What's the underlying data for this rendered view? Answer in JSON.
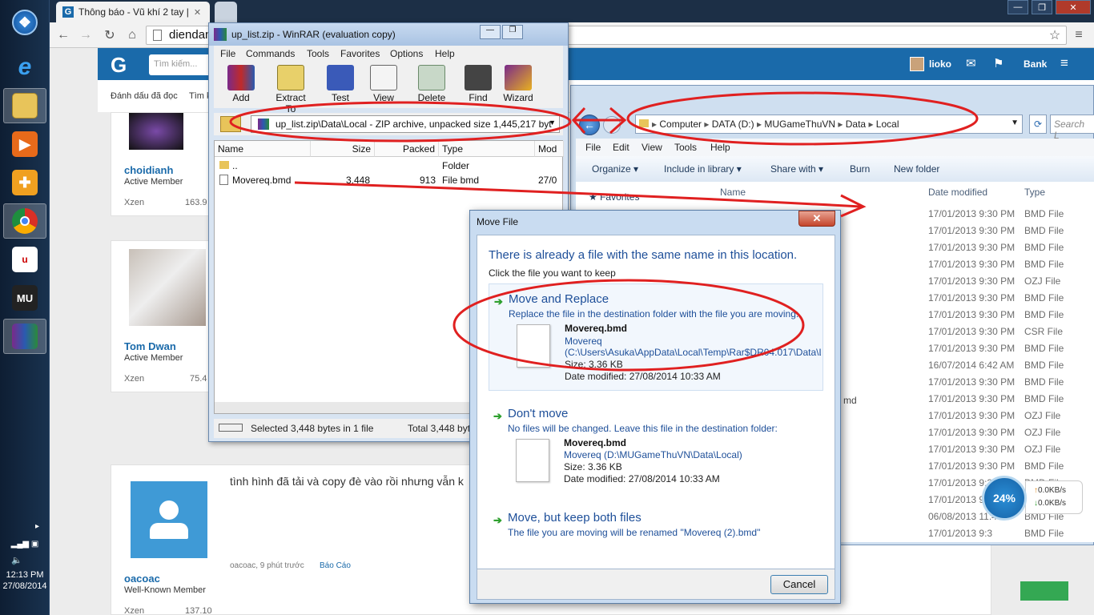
{
  "taskbar": {
    "clock_time": "12:13 PM",
    "clock_date": "27/08/2014"
  },
  "browser": {
    "tab_title": "Thông báo - Vũ khí 2 tay |",
    "url": "diendan"
  },
  "forum": {
    "search_placeholder": "Tìm kiếm...",
    "subnav_mark_read": "Đánh dấu đã đọc",
    "subnav_search": "Tìm k",
    "header_user": "lioko",
    "header_bank": "Bank",
    "posts": [
      {
        "user": "choidianh",
        "role": "Active Member",
        "stat_label": "Xzen",
        "stat_value": "163.9"
      },
      {
        "user": "Tom Dwan",
        "role": "Active Member",
        "stat_label": "Xzen",
        "stat_value": "75.4"
      },
      {
        "user": "oacoac",
        "role": "Well-Known Member",
        "stat_label": "Xzen",
        "stat_value": "137.10",
        "message": "tình hình đã tải và copy đè vào rồi nhưng vẫn k",
        "meta": "oacoac, 9 phút trước",
        "report": "Báo Cáo"
      }
    ]
  },
  "winrar": {
    "title": "up_list.zip - WinRAR (evaluation copy)",
    "menu": [
      "File",
      "Commands",
      "Tools",
      "Favorites",
      "Options",
      "Help"
    ],
    "toolbar": [
      "Add",
      "Extract To",
      "Test",
      "View",
      "Delete",
      "Find",
      "Wizard"
    ],
    "path": "up_list.zip\\Data\\Local - ZIP archive, unpacked size 1,445,217 byt",
    "columns": [
      "Name",
      "Size",
      "Packed",
      "Type",
      "Mod"
    ],
    "rows": [
      {
        "name": "..",
        "size": "",
        "packed": "",
        "type": "Folder",
        "mod": ""
      },
      {
        "name": "Movereq.bmd",
        "size": "3,448",
        "packed": "913",
        "type": "File bmd",
        "mod": "27/0"
      }
    ],
    "status_selected": "Selected 3,448 bytes in 1 file",
    "status_total": "Total 3,448 byt"
  },
  "explorer": {
    "breadcrumb": [
      "Computer",
      "DATA (D:)",
      "MUGameThuVN",
      "Data",
      "Local"
    ],
    "search_placeholder": "Search L",
    "menu": [
      "File",
      "Edit",
      "View",
      "Tools",
      "Help"
    ],
    "commands": [
      "Organize",
      "Include in library",
      "Share with",
      "Burn",
      "New folder"
    ],
    "columns": [
      "Name",
      "Date modified",
      "Type"
    ],
    "favorites": "Favorites",
    "rows": [
      {
        "date": "17/01/2013 9:30 PM",
        "type": "BMD File"
      },
      {
        "date": "17/01/2013 9:30 PM",
        "type": "BMD File"
      },
      {
        "date": "17/01/2013 9:30 PM",
        "type": "BMD File"
      },
      {
        "date": "17/01/2013 9:30 PM",
        "type": "BMD File"
      },
      {
        "date": "17/01/2013 9:30 PM",
        "type": "OZJ File"
      },
      {
        "date": "17/01/2013 9:30 PM",
        "type": "BMD File"
      },
      {
        "date": "17/01/2013 9:30 PM",
        "type": "BMD File"
      },
      {
        "date": "17/01/2013 9:30 PM",
        "type": "CSR File"
      },
      {
        "date": "17/01/2013 9:30 PM",
        "type": "BMD File"
      },
      {
        "date": "16/07/2014 6:42 AM",
        "type": "BMD File"
      },
      {
        "date": "17/01/2013 9:30 PM",
        "type": "BMD File"
      },
      {
        "date": "17/01/2013 9:30 PM",
        "type": "BMD File"
      },
      {
        "date": "17/01/2013 9:30 PM",
        "type": "OZJ File"
      },
      {
        "date": "17/01/2013 9:30 PM",
        "type": "OZJ File"
      },
      {
        "date": "17/01/2013 9:30 PM",
        "type": "OZJ File"
      },
      {
        "date": "17/01/2013 9:30 PM",
        "type": "BMD File"
      },
      {
        "date": "17/01/2013 9:3",
        "type": "BMD File"
      },
      {
        "date": "17/01/2013 9:3",
        "type": "BMD File"
      },
      {
        "date": "06/08/2013 11:4",
        "type": "BMD File"
      },
      {
        "date": "17/01/2013 9:3",
        "type": "BMD File"
      }
    ],
    "partial_name": "md"
  },
  "dialog": {
    "title": "Move File",
    "close": "✕",
    "heading": "There is already a file with the same name in this location.",
    "subheading": "Click the file you want to keep",
    "opt1_title": "Move and Replace",
    "opt1_desc": "Replace the file in the destination folder with the file you are moving:",
    "opt1_fname": "Movereq.bmd",
    "opt1_loc1": "Movereq",
    "opt1_loc2": "(C:\\Users\\Asuka\\AppData\\Local\\Temp\\Rar$DR04.017\\Data\\L",
    "opt1_size": "Size: 3.36 KB",
    "opt1_date": "Date modified: 27/08/2014 10:33 AM",
    "opt2_title": "Don't move",
    "opt2_desc": "No files will be changed. Leave this file in the destination folder:",
    "opt2_fname": "Movereq.bmd",
    "opt2_loc": "Movereq (D:\\MUGameThuVN\\Data\\Local)",
    "opt2_size": "Size: 3.36 KB",
    "opt2_date": "Date modified: 27/08/2014 10:33 AM",
    "opt3_title": "Move, but keep both files",
    "opt3_desc": "The file you are moving will be renamed \"Movereq (2).bmd\"",
    "cancel": "Cancel"
  },
  "net_widget": {
    "percent": "24%",
    "up": "0.0KB/s",
    "down": "0.0KB/s"
  },
  "colors": {
    "annotation": "#e02020",
    "forum_blue": "#1a6aaa",
    "dialog_link": "#1e4f99"
  }
}
